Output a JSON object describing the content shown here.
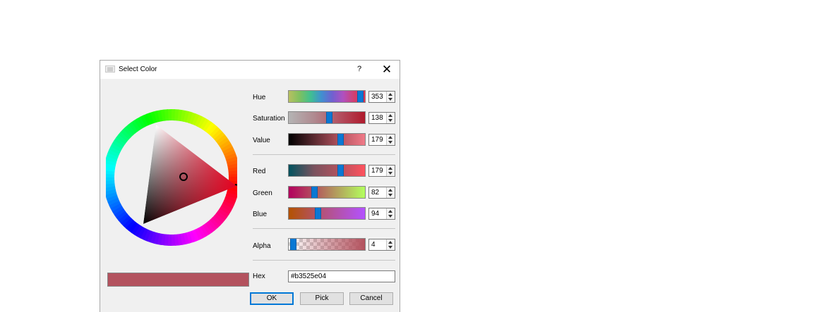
{
  "dialog": {
    "title": "Select Color",
    "help_label": "?",
    "close_label": "✕"
  },
  "hsv": {
    "hue": {
      "label": "Hue",
      "value": "353",
      "fraction": 0.98
    },
    "saturation": {
      "label": "Saturation",
      "value": "138",
      "fraction": 0.54
    },
    "value": {
      "label": "Value",
      "value": "179",
      "fraction": 0.7
    }
  },
  "rgb": {
    "red": {
      "label": "Red",
      "value": "179",
      "fraction": 0.7
    },
    "green": {
      "label": "Green",
      "value": "82",
      "fraction": 0.32
    },
    "blue": {
      "label": "Blue",
      "value": "94",
      "fraction": 0.37
    }
  },
  "alpha": {
    "label": "Alpha",
    "value": "4",
    "fraction": 0.02
  },
  "hex": {
    "label": "Hex",
    "value": "#b3525e04"
  },
  "buttons": {
    "ok": "OK",
    "pick": "Pick",
    "cancel": "Cancel"
  },
  "colors": {
    "current": "#b3525e",
    "accent": "#0a78d4"
  }
}
